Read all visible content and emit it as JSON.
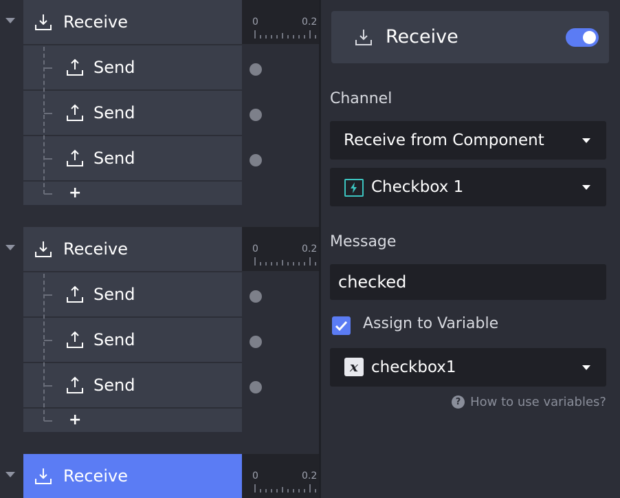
{
  "timeline": {
    "groups": [
      {
        "label": "Receive",
        "selected": false,
        "children": [
          {
            "label": "Send"
          },
          {
            "label": "Send"
          },
          {
            "label": "Send"
          }
        ],
        "add_label": "+"
      },
      {
        "label": "Receive",
        "selected": false,
        "children": [
          {
            "label": "Send"
          },
          {
            "label": "Send"
          },
          {
            "label": "Send"
          }
        ],
        "add_label": "+"
      },
      {
        "label": "Receive",
        "selected": true,
        "children": []
      }
    ],
    "ruler_ticks": [
      "0",
      "0.2"
    ]
  },
  "panel": {
    "title": "Receive",
    "enabled": true,
    "channel": {
      "label": "Channel",
      "source_value": "Receive from Component",
      "component_value": "Checkbox 1"
    },
    "message": {
      "label": "Message",
      "value": "checked"
    },
    "assign_variable": {
      "label": "Assign to Variable",
      "checked": true,
      "variable_icon_glyph": "x",
      "variable_value": "checkbox1"
    },
    "help_link": "How to use variables?",
    "help_icon_glyph": "?"
  },
  "colors": {
    "accent": "#5b7cf4",
    "row_bg": "#3a3e4a",
    "panel_bg": "#2c2e37",
    "field_bg": "#1f2026",
    "component_icon": "#3cc4c0"
  }
}
